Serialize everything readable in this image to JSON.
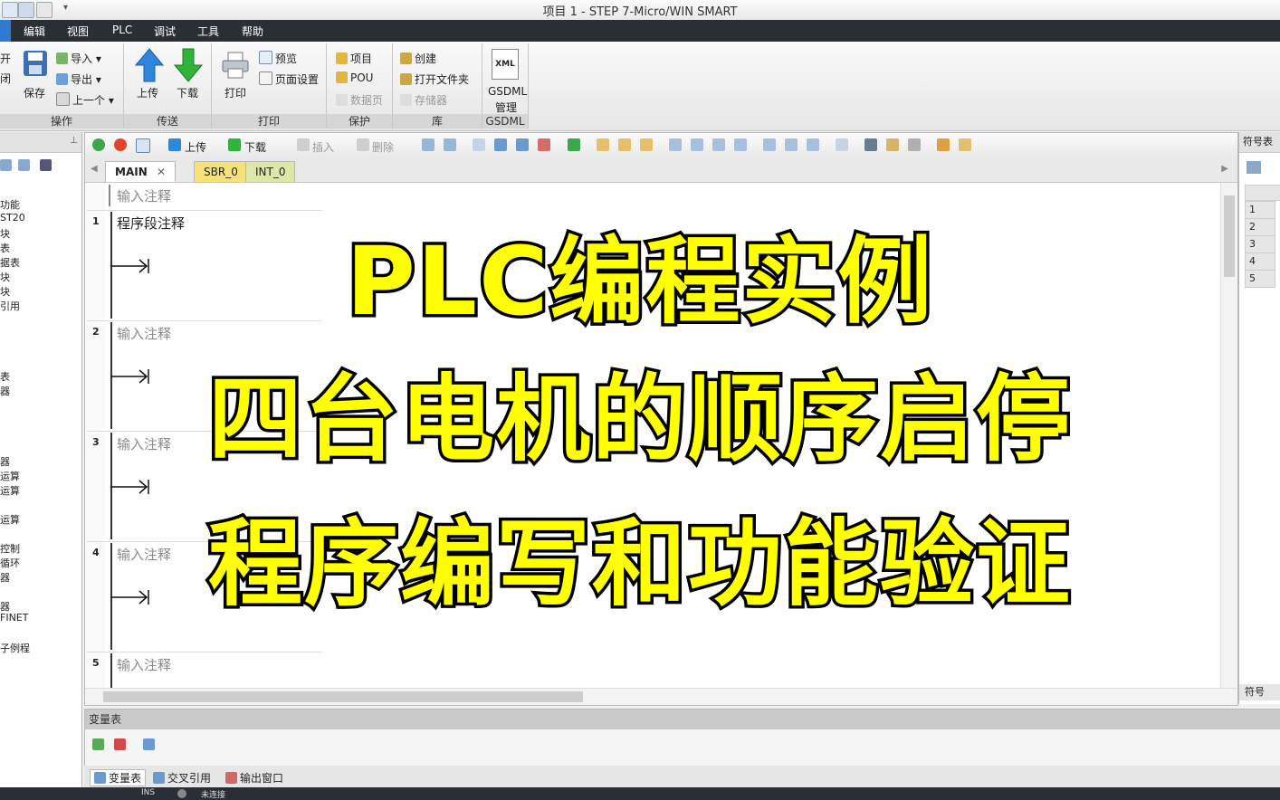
{
  "window": {
    "title": "项目 1 - STEP 7-Micro/WIN SMART"
  },
  "menu": [
    "编辑",
    "视图",
    "PLC",
    "调试",
    "工具",
    "帮助"
  ],
  "ribbon": {
    "operation": {
      "open_label": "开",
      "close_label": "闭",
      "save_label": "保存",
      "import_label": "导入",
      "export_label": "导出",
      "prev_label": "上一个",
      "group_label": "操作"
    },
    "transfer": {
      "upload_label": "上传",
      "download_label": "下载",
      "group_label": "传送"
    },
    "print": {
      "print_label": "打印",
      "preview_label": "预览",
      "page_setup_label": "页面设置",
      "group_label": "打印"
    },
    "protect": {
      "project_label": "项目",
      "pou_label": "POU",
      "datapage_label": "数据页",
      "group_label": "保护"
    },
    "library": {
      "create_label": "创建",
      "open_folder_label": "打开文件夹",
      "memory_label": "存储器",
      "group_label": "库"
    },
    "gsdml": {
      "xml_label": "XML",
      "gsdml_label": "GSDML",
      "manage_label": "管理",
      "group_label": "GSDML"
    }
  },
  "left_tree": [
    "功能",
    "ST20",
    "块",
    "表",
    "据表",
    "块",
    "块",
    "引用",
    "表",
    "器",
    "器",
    "运算",
    "运算",
    "运算",
    "控制",
    "循环",
    "器",
    "器",
    "FINET",
    "子例程"
  ],
  "editor_toolbar": {
    "upload_label": "上传",
    "download_label": "下载",
    "insert_label": "插入",
    "delete_label": "删除"
  },
  "tabs": [
    {
      "label": "MAIN",
      "color": "#ffffff"
    },
    {
      "label": "SBR_0",
      "color": "#f7e27a"
    },
    {
      "label": "INT_0",
      "color": "#dfe7a8"
    }
  ],
  "ladder": {
    "header_comment": "输入注释",
    "networks": [
      {
        "num": "1",
        "comment": "程序段注释"
      },
      {
        "num": "2",
        "comment": "输入注释"
      },
      {
        "num": "3",
        "comment": "输入注释"
      },
      {
        "num": "4",
        "comment": "输入注释"
      },
      {
        "num": "5",
        "comment": "输入注释"
      }
    ]
  },
  "right_panel": {
    "title": "符号表",
    "rows": [
      "1",
      "2",
      "3",
      "4",
      "5"
    ],
    "bottom_label": "符号"
  },
  "var_panel": {
    "title": "变量表"
  },
  "bottom_tabs": [
    "变量表",
    "交叉引用",
    "输出窗口"
  ],
  "status": {
    "ins": "INS",
    "conn": "未连接"
  },
  "overlay": {
    "line1": "PLC编程实例",
    "line2": "四台电机的顺序启停",
    "line3": "程序编写和功能验证"
  },
  "colors": {
    "overlay_text": "#ffff00",
    "overlay_stroke": "#000000",
    "menubar": "#2a2f36"
  }
}
